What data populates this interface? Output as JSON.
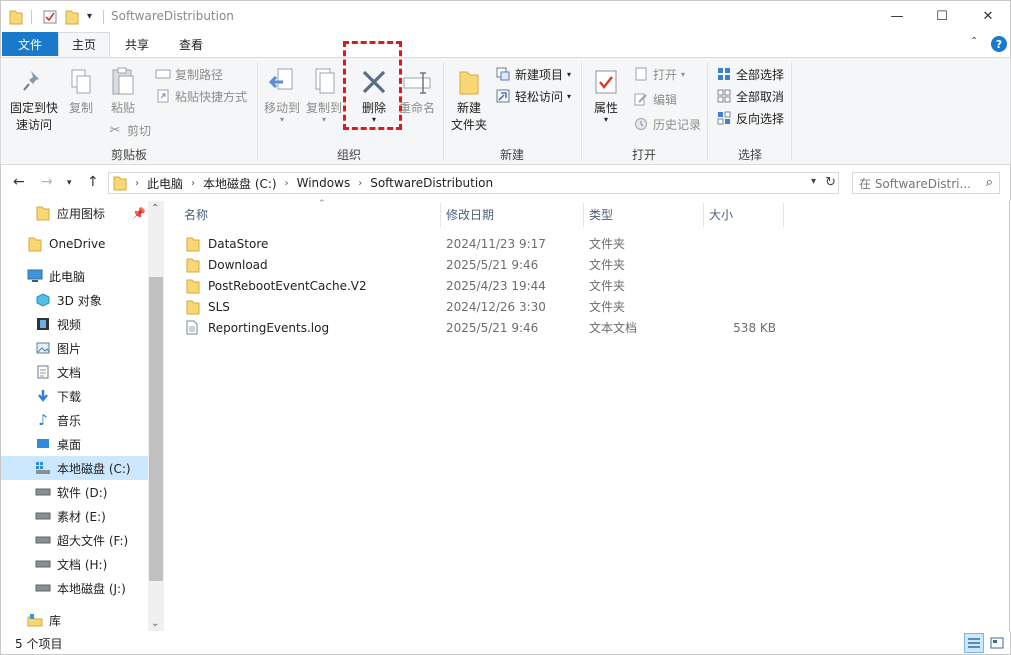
{
  "window": {
    "title": "SoftwareDistribution",
    "minimize": "—",
    "maximize": "☐",
    "close": "✕"
  },
  "tabs": {
    "file": "文件",
    "home": "主页",
    "share": "共享",
    "view": "查看"
  },
  "ribbon": {
    "clipboard": {
      "label": "剪贴板",
      "pin_line1": "固定到快",
      "pin_line2": "速访问",
      "copy": "复制",
      "paste": "粘贴",
      "copy_path": "复制路径",
      "paste_shortcut": "粘贴快捷方式",
      "cut": "剪切"
    },
    "organize": {
      "label": "组织",
      "move_to": "移动到",
      "copy_to": "复制到",
      "delete": "删除",
      "rename": "重命名"
    },
    "new": {
      "label": "新建",
      "new_folder_line1": "新建",
      "new_folder_line2": "文件夹",
      "new_item": "新建项目",
      "easy_access": "轻松访问"
    },
    "open": {
      "label": "打开",
      "properties": "属性",
      "open": "打开",
      "edit": "编辑",
      "history": "历史记录"
    },
    "select": {
      "label": "选择",
      "select_all": "全部选择",
      "select_none": "全部取消",
      "invert": "反向选择"
    }
  },
  "address": {
    "crumbs": [
      "此电脑",
      "本地磁盘 (C:)",
      "Windows",
      "SoftwareDistribution"
    ],
    "search_placeholder": "在 SoftwareDistri..."
  },
  "nav": {
    "quick_pin": "应用图标",
    "onedrive": "OneDrive",
    "this_pc": "此电脑",
    "items": [
      "3D 对象",
      "视频",
      "图片",
      "文档",
      "下载",
      "音乐",
      "桌面",
      "本地磁盘 (C:)",
      "软件 (D:)",
      "素材 (E:)",
      "超大文件 (F:)",
      "文档 (H:)",
      "本地磁盘 (J:)"
    ],
    "library": "库"
  },
  "columns": {
    "name": "名称",
    "date": "修改日期",
    "type": "类型",
    "size": "大小"
  },
  "files": [
    {
      "name": "DataStore",
      "date": "2024/11/23 9:17",
      "type": "文件夹",
      "size": ""
    },
    {
      "name": "Download",
      "date": "2025/5/21 9:46",
      "type": "文件夹",
      "size": ""
    },
    {
      "name": "PostRebootEventCache.V2",
      "date": "2025/4/23 19:44",
      "type": "文件夹",
      "size": ""
    },
    {
      "name": "SLS",
      "date": "2024/12/26 3:30",
      "type": "文件夹",
      "size": ""
    },
    {
      "name": "ReportingEvents.log",
      "date": "2025/5/21 9:46",
      "type": "文本文档",
      "size": "538 KB"
    }
  ],
  "status": {
    "count": "5 个项目"
  },
  "colors": {
    "accent": "#1979ca",
    "folder": "#f8d775",
    "highlight": "#e01a1a",
    "selected": "#cce8ff"
  }
}
